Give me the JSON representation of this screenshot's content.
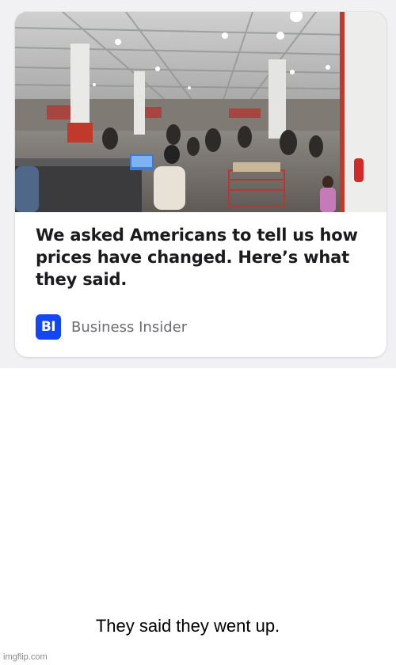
{
  "article_card": {
    "headline": "We asked Americans to tell us how prices have changed. Here’s what they said.",
    "source_logo_text": "BI",
    "source_name": "Business Insider",
    "image_description_icon": "store-checkout-photo",
    "colors": {
      "logo_bg": "#1346f4",
      "headline": "#1b1b1d",
      "source_text": "#6b6b70",
      "backdrop": "#f1f1f4"
    }
  },
  "caption": {
    "text": "They said they went up."
  },
  "watermark": {
    "text": "imgflip.com"
  }
}
